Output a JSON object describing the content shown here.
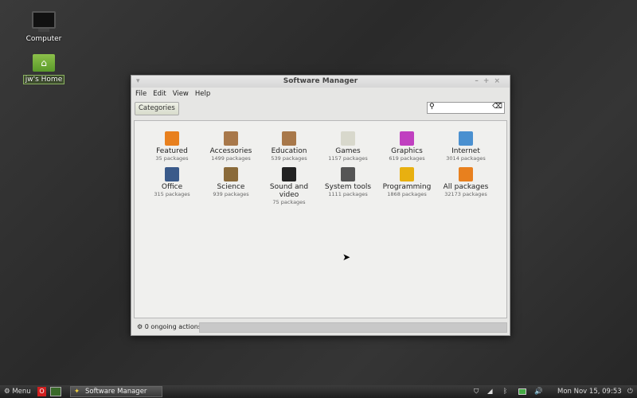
{
  "desktop": {
    "icons": [
      {
        "label": "Computer"
      },
      {
        "label": "jw's Home"
      }
    ]
  },
  "window": {
    "title": "Software Manager",
    "controls": {
      "minimize": "–",
      "maximize": "+",
      "close": "×"
    },
    "menu": [
      "File",
      "Edit",
      "View",
      "Help"
    ],
    "toolbar": {
      "categories_label": "Categories",
      "search_value": ""
    },
    "categories": [
      {
        "name": "Featured",
        "count": "35 packages",
        "color": "#e8801e"
      },
      {
        "name": "Accessories",
        "count": "1499 packages",
        "color": "#a8784a"
      },
      {
        "name": "Education",
        "count": "539 packages",
        "color": "#a8784a"
      },
      {
        "name": "Games",
        "count": "1157 packages",
        "color": "#d8d8cc"
      },
      {
        "name": "Graphics",
        "count": "619 packages",
        "color": "#c040c0"
      },
      {
        "name": "Internet",
        "count": "3014 packages",
        "color": "#4a90d0"
      },
      {
        "name": "Office",
        "count": "315 packages",
        "color": "#3a5a8a"
      },
      {
        "name": "Science",
        "count": "939 packages",
        "color": "#8a6a3a"
      },
      {
        "name": "Sound and video",
        "count": "75 packages",
        "color": "#222222"
      },
      {
        "name": "System tools",
        "count": "1111 packages",
        "color": "#555555"
      },
      {
        "name": "Programming",
        "count": "1868 packages",
        "color": "#e8b010"
      },
      {
        "name": "All packages",
        "count": "32173 packages",
        "color": "#e8801e"
      }
    ],
    "status": "0 ongoing actions"
  },
  "taskbar": {
    "menu_label": "Menu",
    "task": "Software Manager",
    "clock": "Mon Nov 15, 09:53"
  }
}
